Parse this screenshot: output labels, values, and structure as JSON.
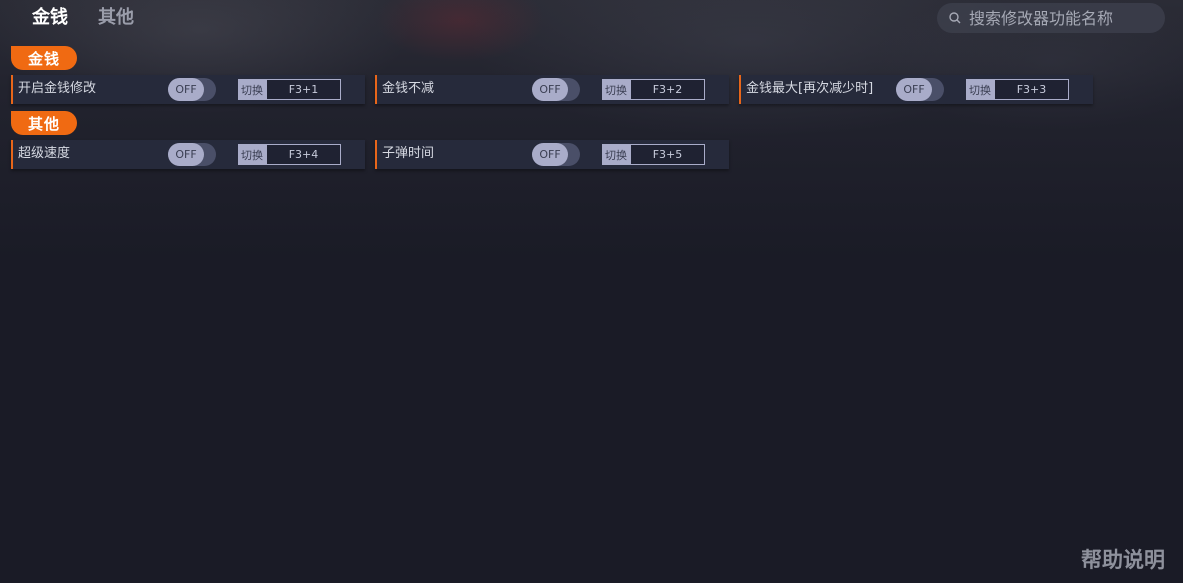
{
  "tabs": [
    {
      "label": "金钱",
      "active": true
    },
    {
      "label": "其他",
      "active": false
    }
  ],
  "search": {
    "placeholder": "搜索修改器功能名称",
    "icon": "search-icon"
  },
  "sections": [
    {
      "title": "金钱",
      "items": [
        {
          "label": "开启金钱修改",
          "state": "OFF",
          "hotkey_label": "切换",
          "hotkey": "F3+1"
        },
        {
          "label": "金钱不减",
          "state": "OFF",
          "hotkey_label": "切换",
          "hotkey": "F3+2"
        },
        {
          "label": "金钱最大[再次减少时]",
          "state": "OFF",
          "hotkey_label": "切换",
          "hotkey": "F3+3"
        }
      ]
    },
    {
      "title": "其他",
      "items": [
        {
          "label": "超级速度",
          "state": "OFF",
          "hotkey_label": "切换",
          "hotkey": "F3+4"
        },
        {
          "label": "子弹时间",
          "state": "OFF",
          "hotkey_label": "切换",
          "hotkey": "F3+5"
        }
      ]
    }
  ],
  "help": {
    "label": "帮助说明"
  },
  "colors": {
    "accent": "#f06a12",
    "background": "#1a1b26",
    "card": "#262a3b",
    "toggle_off": "#a9acc9"
  }
}
